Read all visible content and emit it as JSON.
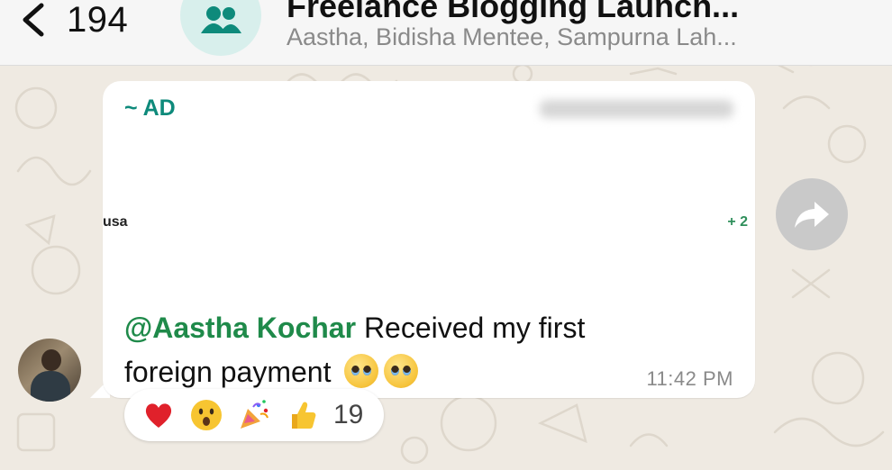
{
  "header": {
    "back_count": "194",
    "group_title": "Freelance Blogging Launch...",
    "group_members": "Aastha, Bidisha Mentee, Sampurna Lah..."
  },
  "message": {
    "sender_name": "~ AD",
    "clipped_left_text": "usa",
    "clipped_right_text": "+ 2",
    "mention": "@Aastha Kochar",
    "text": " Received my first foreign payment",
    "time": "11:42 PM"
  },
  "reactions": {
    "emojis": [
      "heart",
      "surprised-face",
      "party-popper",
      "thumbs-up"
    ],
    "count": "19"
  },
  "colors": {
    "header_bg": "#f6f6f6",
    "chat_bg": "#efeae2",
    "sender_color": "#0e8a7b",
    "mention_color": "#1f8a4a",
    "bubble_bg": "#ffffff"
  }
}
